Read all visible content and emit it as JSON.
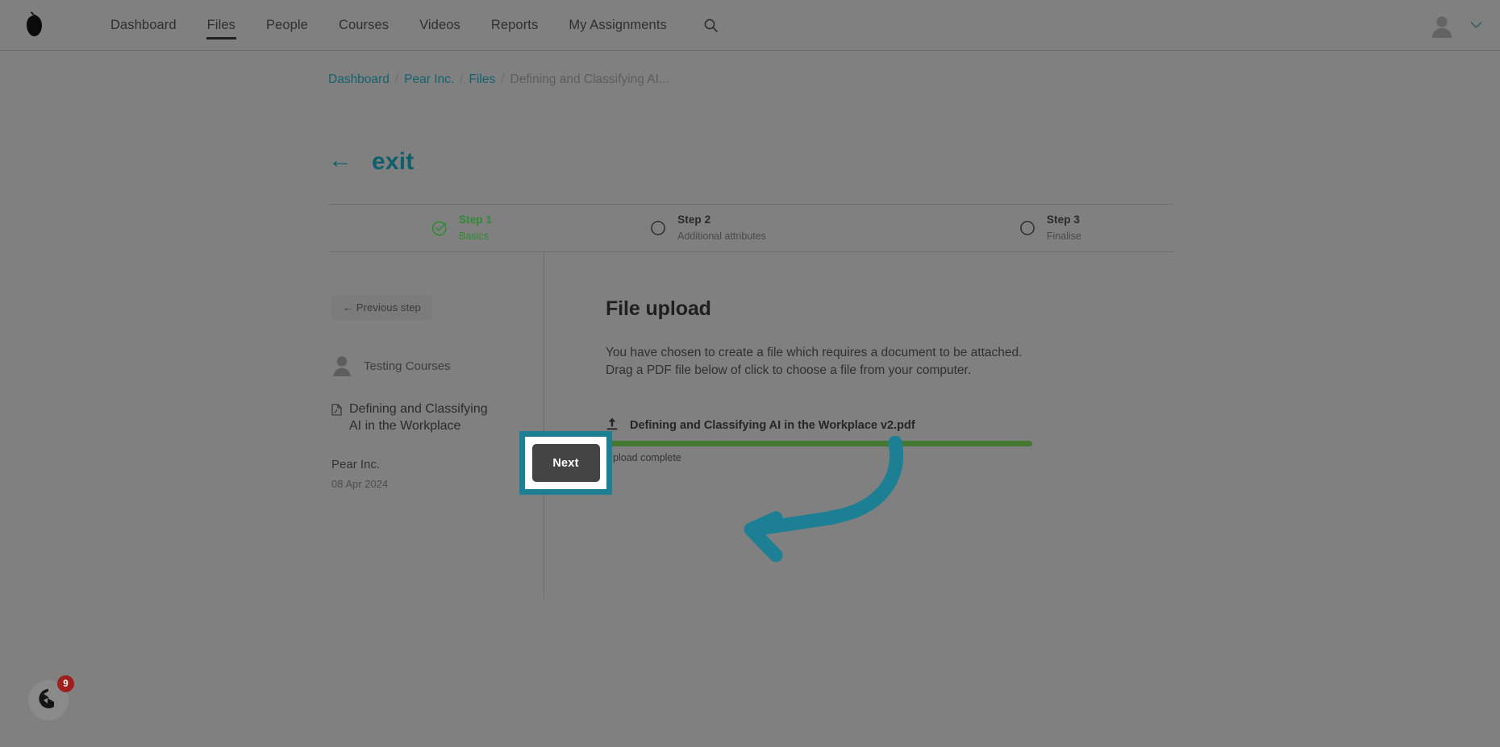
{
  "topnav": {
    "logo_icon": "pear-logo-icon",
    "items": [
      {
        "label": "Dashboard",
        "active": false
      },
      {
        "label": "Files",
        "active": true
      },
      {
        "label": "People",
        "active": false
      },
      {
        "label": "Courses",
        "active": false
      },
      {
        "label": "Videos",
        "active": false
      },
      {
        "label": "Reports",
        "active": false
      },
      {
        "label": "My Assignments",
        "active": false
      }
    ],
    "search_icon": "search-icon",
    "avatar_icon": "user-avatar-icon",
    "chevron_icon": "chevron-down-icon"
  },
  "breadcrumb": {
    "separator": "/",
    "items": [
      {
        "label": "Dashboard",
        "current": false
      },
      {
        "label": "Pear Inc.",
        "current": false
      },
      {
        "label": "Files",
        "current": false
      },
      {
        "label": "Defining and Classifying AI...",
        "current": true
      }
    ]
  },
  "exit": {
    "arrow": "←",
    "label": "exit"
  },
  "stepper": {
    "steps": [
      {
        "title": "Step 1",
        "subtitle": "Basics",
        "state": "done",
        "icon": "check-circle-icon"
      },
      {
        "title": "Step 2",
        "subtitle": "Additional attributes",
        "state": "pending",
        "icon": "circle-icon"
      },
      {
        "title": "Step 3",
        "subtitle": "Finalise",
        "state": "pending",
        "icon": "circle-icon"
      }
    ]
  },
  "sidebar": {
    "previous_step_label": "← Previous step",
    "owner": {
      "avatar_icon": "user-avatar-icon",
      "name": "Testing Courses"
    },
    "document": {
      "icon": "pdf-file-icon",
      "title": "Defining and Classifying AI in the Workplace"
    },
    "organisation": "Pear Inc.",
    "date": "08 Apr 2024"
  },
  "main": {
    "title": "File upload",
    "description": "You have chosen to create a file which requires a document to be attached. Drag a PDF file below of click to choose a file from your computer.",
    "upload": {
      "icon": "upload-icon",
      "filename": "Defining and Classifying AI in the Workplace v2.pdf",
      "progress_percent": 100,
      "status": "Upload complete",
      "bar_color": "#44772f"
    },
    "next_label": "Next"
  },
  "annotation": {
    "arrow_icon": "curved-left-arrow-icon",
    "color": "#1c7f94",
    "highlight_target": "next-button"
  },
  "chat": {
    "icon": "chat-bubble-icon",
    "badge_count": "9",
    "badge_color": "#9f1f1f"
  }
}
